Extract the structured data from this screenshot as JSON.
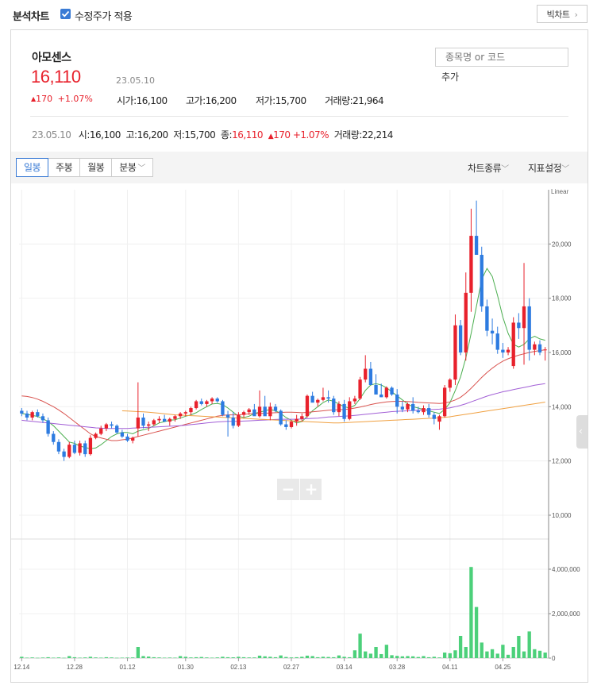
{
  "header": {
    "title": "분석차트",
    "adjusted_label": "수정주가 적용",
    "big_chart_label": "빅차트"
  },
  "stock": {
    "name": "아모센스",
    "price": "16,110",
    "date": "23.05.10",
    "change": "170",
    "change_pct": "+1.07%",
    "open_label": "시가",
    "open": "16,100",
    "high_label": "고가",
    "high": "16,200",
    "low_label": "저가",
    "low": "15,700",
    "volume_label": "거래량",
    "volume": "21,964"
  },
  "search": {
    "placeholder": "종목명 or 코드",
    "add_label": "추가"
  },
  "summary": {
    "date": "23.05.10",
    "open_label": "시",
    "open": "16,100",
    "high_label": "고",
    "high": "16,200",
    "low_label": "저",
    "low": "15,700",
    "close_label": "종",
    "close": "16,110",
    "change": "170",
    "change_pct": "+1.07%",
    "volume_label": "거래량",
    "volume": "22,214"
  },
  "toolbar": {
    "tabs": [
      "일봉",
      "주봉",
      "월봉",
      "분봉"
    ],
    "chart_type_label": "차트종류",
    "indicator_label": "지표설정"
  },
  "colors": {
    "up": "#e8212c",
    "down": "#2d7be0",
    "ma5": "#4caf50",
    "ma20": "#d9534f",
    "ma60": "#a25fd6",
    "ma120": "#f0a040",
    "volume": "#4cd07a"
  },
  "chart_data": {
    "type": "candlestick",
    "price_scale_label": "Linear",
    "y_ticks": [
      "20,000",
      "18,000",
      "16,000",
      "14,000",
      "12,000",
      "10,000"
    ],
    "y_tick_values": [
      20000,
      18000,
      16000,
      14000,
      12000,
      10000
    ],
    "ylim": [
      10000,
      22000
    ],
    "volume_ticks": [
      "4,000,000",
      "2,000,000",
      "0"
    ],
    "volume_tick_values": [
      4000000,
      2000000,
      0
    ],
    "volume_lim": [
      0,
      5000000
    ],
    "x_ticks": [
      "12.14",
      "12.28",
      "01.12",
      "01.30",
      "02.13",
      "02.27",
      "03.14",
      "03.28",
      "04.11",
      "04.25"
    ],
    "x_tick_index": [
      0,
      10,
      20,
      31,
      41,
      51,
      61,
      71,
      81,
      91
    ],
    "candles": [
      [
        13850,
        13950,
        13650,
        13750
      ],
      [
        13750,
        13850,
        13500,
        13600
      ],
      [
        13600,
        13850,
        13500,
        13800
      ],
      [
        13800,
        13900,
        13600,
        13650
      ],
      [
        13650,
        13750,
        13400,
        13500
      ],
      [
        13500,
        13600,
        12900,
        13000
      ],
      [
        13000,
        13100,
        12600,
        12700
      ],
      [
        12700,
        12800,
        12250,
        12350
      ],
      [
        12350,
        12450,
        12000,
        12150
      ],
      [
        12150,
        12700,
        12100,
        12600
      ],
      [
        12600,
        12750,
        12250,
        12300
      ],
      [
        12300,
        12750,
        12200,
        12650
      ],
      [
        12650,
        12750,
        12150,
        12250
      ],
      [
        12250,
        12950,
        12200,
        12850
      ],
      [
        12850,
        13050,
        12800,
        13000
      ],
      [
        13000,
        13300,
        12950,
        13200
      ],
      [
        13200,
        13400,
        13100,
        13350
      ],
      [
        13350,
        13450,
        13200,
        13300
      ],
      [
        13300,
        13350,
        13000,
        13050
      ],
      [
        13050,
        13150,
        12850,
        12900
      ],
      [
        12900,
        13000,
        12700,
        12750
      ],
      [
        12750,
        12900,
        12650,
        12850
      ],
      [
        13200,
        14900,
        12900,
        13600
      ],
      [
        13600,
        13750,
        13200,
        13300
      ],
      [
        13300,
        13450,
        13100,
        13350
      ],
      [
        13350,
        13550,
        13300,
        13500
      ],
      [
        13500,
        13650,
        13400,
        13550
      ],
      [
        13550,
        13700,
        13450,
        13450
      ],
      [
        13450,
        13600,
        13300,
        13550
      ],
      [
        13550,
        13700,
        13450,
        13650
      ],
      [
        13650,
        13800,
        13550,
        13750
      ],
      [
        13750,
        13850,
        13650,
        13800
      ],
      [
        13800,
        14000,
        13700,
        13950
      ],
      [
        13950,
        14250,
        13900,
        14200
      ],
      [
        14200,
        14300,
        14050,
        14100
      ],
      [
        14100,
        14250,
        14000,
        14200
      ],
      [
        14200,
        14350,
        14100,
        14300
      ],
      [
        14300,
        14350,
        14150,
        14200
      ],
      [
        14200,
        14250,
        13650,
        13700
      ],
      [
        13700,
        13850,
        12900,
        13600
      ],
      [
        13600,
        13800,
        13200,
        13300
      ],
      [
        13300,
        13800,
        13250,
        13700
      ],
      [
        13700,
        13850,
        13600,
        13800
      ],
      [
        13800,
        13950,
        13700,
        13900
      ],
      [
        13900,
        14100,
        13800,
        13650
      ],
      [
        13650,
        14600,
        13600,
        14000
      ],
      [
        14000,
        14400,
        13850,
        13650
      ],
      [
        13650,
        14150,
        13500,
        14000
      ],
      [
        14000,
        14100,
        13800,
        13850
      ],
      [
        13850,
        13900,
        13300,
        13350
      ],
      [
        13350,
        13500,
        13150,
        13250
      ],
      [
        13250,
        13500,
        13200,
        13450
      ],
      [
        13450,
        13700,
        13300,
        13550
      ],
      [
        13550,
        13750,
        13450,
        13650
      ],
      [
        13650,
        14450,
        13600,
        14400
      ],
      [
        14400,
        14550,
        14200,
        14150
      ],
      [
        14150,
        14300,
        14000,
        14250
      ],
      [
        14250,
        14700,
        14200,
        14350
      ],
      [
        14350,
        14600,
        14150,
        14300
      ],
      [
        14300,
        14400,
        13700,
        13800
      ],
      [
        13800,
        14200,
        13650,
        14100
      ],
      [
        14100,
        14250,
        13450,
        13550
      ],
      [
        13550,
        14350,
        13500,
        14200
      ],
      [
        14200,
        14400,
        14100,
        14300
      ],
      [
        14300,
        15100,
        14250,
        15000
      ],
      [
        15000,
        15900,
        14900,
        15400
      ],
      [
        15400,
        15650,
        15000,
        14800
      ],
      [
        14800,
        15200,
        14500,
        14450
      ],
      [
        14450,
        14850,
        14350,
        14350
      ],
      [
        14350,
        14750,
        14300,
        14700
      ],
      [
        14700,
        14750,
        14400,
        14450
      ],
      [
        14450,
        14650,
        13750,
        14000
      ],
      [
        14000,
        14200,
        13800,
        13900
      ],
      [
        13900,
        14150,
        13800,
        14100
      ],
      [
        14100,
        14350,
        13750,
        13850
      ],
      [
        13850,
        14000,
        13750,
        13800
      ],
      [
        13800,
        14050,
        13700,
        13950
      ],
      [
        13950,
        14100,
        13600,
        13700
      ],
      [
        13700,
        13800,
        13350,
        13550
      ],
      [
        13450,
        13700,
        13150,
        13650
      ],
      [
        13650,
        14800,
        13600,
        14700
      ],
      [
        14700,
        15050,
        14550,
        15000
      ],
      [
        15000,
        17400,
        14800,
        17000
      ],
      [
        17000,
        17200,
        15900,
        16000
      ],
      [
        16000,
        18950,
        15700,
        18200
      ],
      [
        18200,
        21300,
        17500,
        20300
      ],
      [
        20300,
        21600,
        19600,
        19600
      ],
      [
        19600,
        19900,
        17500,
        17700
      ],
      [
        17700,
        17950,
        16600,
        16800
      ],
      [
        16800,
        17250,
        16300,
        16700
      ],
      [
        16700,
        16950,
        15950,
        16100
      ],
      [
        16100,
        16350,
        15800,
        16000
      ],
      [
        16000,
        16200,
        15900,
        16100
      ],
      [
        15500,
        17300,
        15400,
        17100
      ],
      [
        17100,
        17450,
        16500,
        16900
      ],
      [
        16900,
        19300,
        15550,
        17700
      ],
      [
        17700,
        18000,
        15700,
        16100
      ],
      [
        16100,
        16400,
        15900,
        16300
      ],
      [
        16300,
        16450,
        15900,
        16000
      ],
      [
        16100,
        16200,
        15700,
        16110
      ]
    ],
    "volume": [
      60000,
      20000,
      30000,
      15000,
      25000,
      40000,
      20000,
      30000,
      15000,
      90000,
      40000,
      20000,
      30000,
      60000,
      30000,
      20000,
      40000,
      30000,
      15000,
      20000,
      25000,
      30000,
      500000,
      90000,
      70000,
      40000,
      30000,
      20000,
      25000,
      20000,
      90000,
      60000,
      30000,
      40000,
      50000,
      30000,
      20000,
      30000,
      60000,
      40000,
      35000,
      60000,
      40000,
      30000,
      30000,
      110000,
      80000,
      60000,
      40000,
      120000,
      50000,
      30000,
      40000,
      60000,
      110000,
      90000,
      40000,
      60000,
      50000,
      40000,
      120000,
      60000,
      40000,
      350000,
      1100000,
      300000,
      200000,
      500000,
      180000,
      600000,
      130000,
      100000,
      80000,
      90000,
      80000,
      50000,
      90000,
      40000,
      60000,
      30000,
      250000,
      220000,
      350000,
      1000000,
      500000,
      4100000,
      2300000,
      700000,
      300000,
      400000,
      200000,
      600000,
      150000,
      500000,
      1000000,
      300000,
      1200000,
      400000,
      330000,
      250000
    ],
    "moving_averages": [
      {
        "values": [
          13750,
          13720,
          13680,
          13640,
          13560,
          13450,
          13300,
          13100,
          12900,
          12700,
          12650,
          12550,
          12500,
          12450,
          12480,
          12600,
          12750,
          12900,
          13000,
          13050,
          13050,
          13000,
          13100,
          13150,
          13200,
          13300,
          13400,
          13450,
          13500,
          13520,
          13580,
          13650,
          13700,
          13780,
          13900,
          14000,
          14100,
          14120,
          14080,
          13950,
          13800,
          13650,
          13600,
          13650,
          13750,
          13800,
          13850,
          13900,
          13850,
          13750,
          13600,
          13500,
          13400,
          13450,
          13650,
          13850,
          14000,
          14150,
          14250,
          14200,
          14100,
          14000,
          13950,
          14050,
          14300,
          14600,
          14800,
          14850,
          14800,
          14700,
          14550,
          14400,
          14250,
          14100,
          14000,
          13950,
          13900,
          13850,
          13800,
          13750,
          13900,
          14150,
          14600,
          15100,
          15800,
          16700,
          17700,
          18700,
          19100,
          18800,
          18100,
          17300,
          16700,
          16300,
          16200,
          16300,
          16500,
          16600,
          16500,
          16450
        ]
      },
      {
        "values": [
          14400,
          14380,
          14340,
          14280,
          14200,
          14100,
          14000,
          13880,
          13750,
          13600,
          13450,
          13300,
          13150,
          13000,
          12900,
          12850,
          12800,
          12750,
          12750,
          12780,
          12800,
          12850,
          12900,
          12950,
          13000,
          13050,
          13100,
          13150,
          13200,
          13250,
          13300,
          13350,
          13400,
          13450,
          13500,
          13550,
          13600,
          13650,
          13680,
          13700,
          13700,
          13700,
          13720,
          13740,
          13750,
          13750,
          13760,
          13770,
          13780,
          13790,
          13800,
          13800,
          13790,
          13780,
          13790,
          13810,
          13830,
          13850,
          13870,
          13880,
          13890,
          13900,
          13920,
          13950,
          13990,
          14030,
          14080,
          14120,
          14150,
          14180,
          14190,
          14200,
          14200,
          14190,
          14180,
          14160,
          14150,
          14140,
          14130,
          14120,
          14140,
          14180,
          14250,
          14350,
          14500,
          14680,
          14880,
          15080,
          15260,
          15420,
          15560,
          15680,
          15770,
          15840,
          15900,
          15950,
          16000,
          16040,
          16070,
          16100
        ]
      },
      {
        "values": [
          13500,
          13480,
          13460,
          13440,
          13420,
          13400,
          13380,
          13360,
          13340,
          13320,
          13300,
          13280,
          13260,
          13240,
          13220,
          13210,
          13200,
          13200,
          13200,
          13200,
          13200,
          13210,
          13220,
          13230,
          13240,
          13250,
          13260,
          13270,
          13280,
          13290,
          13300,
          13320,
          13340,
          13360,
          13380,
          13400,
          13420,
          13440,
          13450,
          13460,
          13460,
          13460,
          13470,
          13480,
          13490,
          13500,
          13510,
          13520,
          13530,
          13540,
          13540,
          13540,
          13540,
          13550,
          13560,
          13570,
          13580,
          13600,
          13620,
          13630,
          13640,
          13650,
          13660,
          13680,
          13700,
          13720,
          13740,
          13760,
          13780,
          13800,
          13820,
          13830,
          13840,
          13850,
          13860,
          13870,
          13880,
          13890,
          13900,
          13910,
          13930,
          13960,
          14000,
          14050,
          14110,
          14180,
          14250,
          14320,
          14390,
          14450,
          14500,
          14550,
          14590,
          14630,
          14670,
          14710,
          14750,
          14790,
          14820,
          14850
        ]
      },
      {
        "values": [
          null,
          null,
          null,
          null,
          null,
          null,
          null,
          null,
          null,
          null,
          null,
          null,
          null,
          null,
          null,
          null,
          null,
          null,
          null,
          13850,
          13840,
          13830,
          13820,
          13810,
          13800,
          13780,
          13760,
          13740,
          13720,
          13700,
          13690,
          13680,
          13670,
          13660,
          13650,
          13640,
          13630,
          13620,
          13610,
          13600,
          13590,
          13580,
          13570,
          13560,
          13550,
          13540,
          13530,
          13520,
          13510,
          13500,
          13490,
          13480,
          13470,
          13460,
          13450,
          13440,
          13430,
          13420,
          13410,
          13400,
          13400,
          13410,
          13420,
          13430,
          13440,
          13450,
          13460,
          13470,
          13480,
          13490,
          13500,
          13510,
          13520,
          13530,
          13540,
          13550,
          13560,
          13570,
          13580,
          13590,
          13610,
          13630,
          13660,
          13690,
          13720,
          13750,
          13780,
          13810,
          13840,
          13870,
          13900,
          13930,
          13960,
          13990,
          14020,
          14050,
          14080,
          14110,
          14140,
          14170
        ]
      }
    ]
  }
}
